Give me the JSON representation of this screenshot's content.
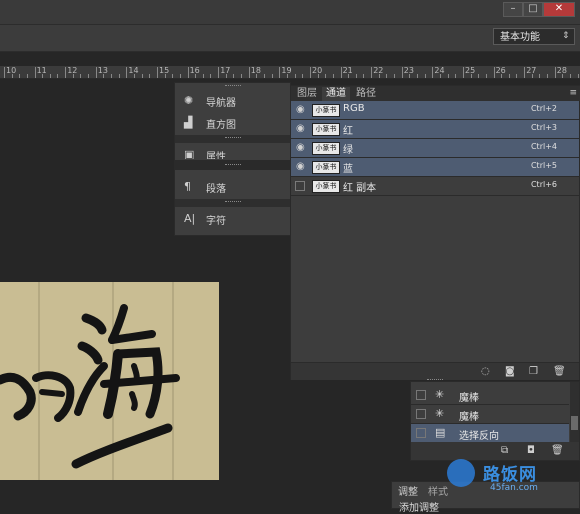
{
  "window": {
    "minimize": "–",
    "maximize": "□",
    "close": "✕"
  },
  "options_bar": {
    "workspace": "基本功能"
  },
  "ruler": {
    "ticks": [
      "10",
      "11",
      "12",
      "13",
      "14",
      "15",
      "16",
      "17",
      "18",
      "19",
      "20",
      "21",
      "22",
      "23",
      "24",
      "25",
      "26",
      "27",
      "28"
    ]
  },
  "dock": {
    "items": [
      {
        "icon": "navigator-icon",
        "glyph": "✺",
        "label": "导航器"
      },
      {
        "icon": "histogram-icon",
        "glyph": "▟",
        "label": "直方图"
      },
      {
        "icon": "properties-icon",
        "glyph": "▣",
        "label": "属性"
      },
      {
        "icon": "paragraph-icon",
        "glyph": "¶",
        "label": "段落"
      },
      {
        "icon": "character-icon",
        "glyph": "A|",
        "label": "字符"
      }
    ]
  },
  "channels_panel": {
    "tabs": [
      "图层",
      "通道",
      "路径"
    ],
    "active_tab": "通道",
    "rows": [
      {
        "name": "RGB",
        "shortcut": "Ctrl+2",
        "visible": true,
        "selected": true
      },
      {
        "name": "红",
        "shortcut": "Ctrl+3",
        "visible": true,
        "selected": true
      },
      {
        "name": "绿",
        "shortcut": "Ctrl+4",
        "visible": true,
        "selected": true
      },
      {
        "name": "蓝",
        "shortcut": "Ctrl+5",
        "visible": true,
        "selected": true
      },
      {
        "name": "红 副本",
        "shortcut": "Ctrl+6",
        "visible": false,
        "selected": false
      }
    ],
    "thumb_text": "小篆书海"
  },
  "history_panel": {
    "rows": [
      {
        "icon": "magic-wand-icon",
        "glyph": "✳",
        "label": "魔棒",
        "selected": false
      },
      {
        "icon": "magic-wand-icon",
        "glyph": "✳",
        "label": "魔棒",
        "selected": false
      },
      {
        "icon": "document-icon",
        "glyph": "▤",
        "label": "选择反向",
        "selected": true
      }
    ]
  },
  "adjustments_panel": {
    "tabs": [
      "调整",
      "样式"
    ],
    "hint": "添加调整"
  },
  "watermark": {
    "title": "路饭网",
    "url": "45fan.com"
  },
  "colors": {
    "selected_row": "#4e5c72",
    "panel": "#3d3d3d",
    "canvas_bg": "#262626",
    "paper": "#c9bd93"
  }
}
